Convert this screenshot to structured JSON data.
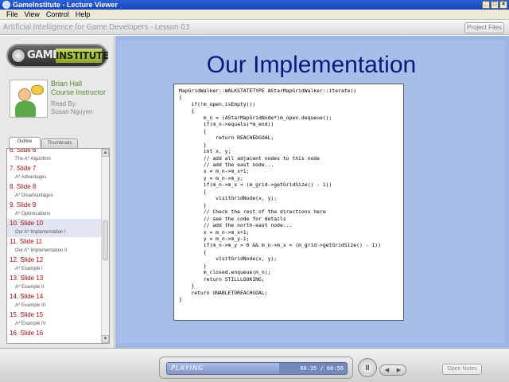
{
  "window": {
    "title": "GameInstitute - Lecture Viewer",
    "buttons": [
      "_",
      "□",
      "×"
    ]
  },
  "menu": [
    "File",
    "View",
    "Control",
    "Help"
  ],
  "lesson": {
    "title": "Artificial Intelligence for Game Developers - Lesson 03",
    "project_files": "Project Files"
  },
  "logo": {
    "part1": "GAME",
    "part2": "INSTITUTE"
  },
  "instructor": {
    "name": "Brian Hall",
    "role": "Course Instructor",
    "read_by_label": "Read By:",
    "read_by_name": "Susan Nguyen"
  },
  "tabs": {
    "outline": "Outline",
    "thumbnails": "Thumbnails"
  },
  "outline": [
    {
      "slide": "6. Slide 6",
      "sub": "The A* Algorithm"
    },
    {
      "slide": "7. Slide 7",
      "sub": "A* Advantages"
    },
    {
      "slide": "8. Slide 8",
      "sub": "A* Disadvantages"
    },
    {
      "slide": "9. Slide 9",
      "sub": "A* Optimizations"
    },
    {
      "slide": "10. Slide 10",
      "sub": "Our A* Implementation I",
      "active": true
    },
    {
      "slide": "11. Slide 11",
      "sub": "Our A* Implementation II"
    },
    {
      "slide": "12. Slide 12",
      "sub": "A* Example I"
    },
    {
      "slide": "13. Slide 13",
      "sub": "A* Example II"
    },
    {
      "slide": "14. Slide 14",
      "sub": "A* Example III"
    },
    {
      "slide": "15. Slide 15",
      "sub": "A* Example IV"
    },
    {
      "slide": "16. Slide 16",
      "sub": ""
    }
  ],
  "slide": {
    "title": "Our Implementation",
    "code": [
      "MapGridWalker::WALKSTATETYPE AStarMapGridWalker::iterate()",
      "{",
      "    if(!m_open.isEmpty())",
      "    {",
      "        m_n = (AStarMapGridNode*)m_open.dequeue();",
      "        if(m_n->equals(*m_end))",
      "        {",
      "            return REACHEDGOAL;",
      "        }",
      "        int x, y;",
      "        // add all adjacent nodes to this node",
      "        // add the east node...",
      "        x = m_n->m_x+1;",
      "        y = m_n->m_y;",
      "        if(m_n->m_x < (m_grid->getGridSize() - 1))",
      "        {",
      "            visitGridNode(x, y);",
      "        }",
      "        // Check the rest of the directions here",
      "        // see the code for details",
      "        // add the north-east node...",
      "        x = m_n->m_x+1;",
      "        y = m_n->m_y-1;",
      "        if(m_n->m_y > 0 && m_n->m_x < (m_grid->getGridSize() - 1))",
      "        {",
      "            visitGridNode(x, y);",
      "        }",
      "",
      "        m_closed.enqueue(m_n);",
      "        return STILLLOOKING;",
      "    }",
      "",
      "    return UNABLETOREACHGOAL;",
      "}"
    ]
  },
  "player": {
    "status": "PLAYING",
    "time": "00:35 / 00:56",
    "progress_fraction": 0.625,
    "pause_label": "II",
    "prev_label": "◀",
    "next_label": "▶",
    "open_notes": "Open Notes"
  }
}
